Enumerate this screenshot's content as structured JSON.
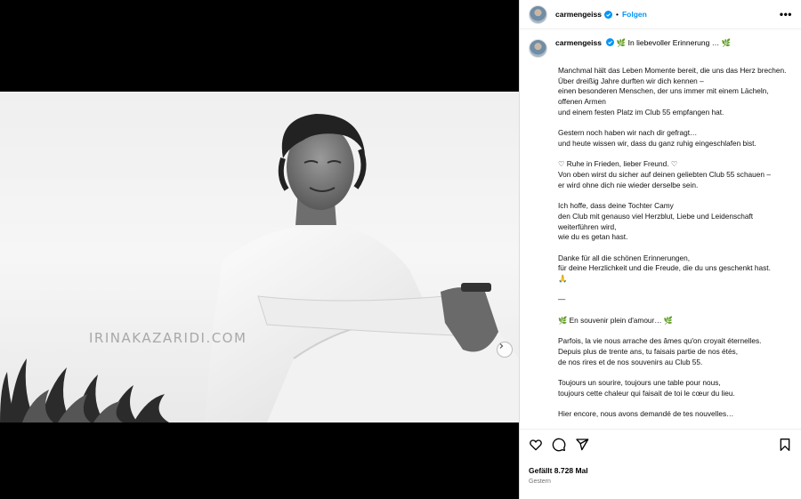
{
  "post": {
    "watermark": "IRINAKAZARIDI.COM",
    "carousel_dots": 2
  },
  "header": {
    "username": "carmengeiss",
    "separator": "•",
    "follow_label": "Folgen",
    "more_label": "•••",
    "verified_color": "#0095f6"
  },
  "caption": {
    "username": "carmengeiss",
    "first_line": "🌿 In liebevoller Erinnerung … 🌿",
    "paragraphs": [
      [
        "Manchmal hält das Leben Momente bereit, die uns das Herz brechen.",
        "Über dreißig Jahre durften wir dich kennen –",
        "einen besonderen Menschen, der uns immer mit einem Lächeln, offenen Armen",
        "und einem festen Platz im Club 55 empfangen hat."
      ],
      [
        "Gestern noch haben wir nach dir gefragt…",
        "und heute wissen wir, dass du ganz ruhig eingeschlafen bist."
      ],
      [
        "♡ Ruhe in Frieden, lieber Freund. ♡",
        "Von oben wirst du sicher auf deinen geliebten Club 55 schauen –",
        "er wird ohne dich nie wieder derselbe sein."
      ],
      [
        "Ich hoffe, dass deine Tochter Camy",
        "den Club mit genauso viel Herzblut, Liebe und Leidenschaft weiterführen wird,",
        "wie du es getan hast."
      ],
      [
        "Danke für all die schönen Erinnerungen,",
        "für deine Herzlichkeit und die Freude, die du uns geschenkt hast.",
        "🙏"
      ],
      [
        "—"
      ],
      [
        "🌿 En souvenir plein d'amour… 🌿"
      ],
      [
        "Parfois, la vie nous arrache des âmes qu'on croyait éternelles.",
        "Depuis plus de trente ans, tu faisais partie de nos étés,",
        "de nos rires et de nos souvenirs au Club 55."
      ],
      [
        "Toujours un sourire, toujours une table pour nous,",
        "toujours cette chaleur qui faisait de toi le cœur du lieu."
      ],
      [
        "Hier encore, nous avons demandé de tes nouvelles…"
      ]
    ]
  },
  "footer": {
    "likes": "Gefällt 8.728 Mal",
    "date": "Gestern"
  },
  "icons": [
    "heart-icon",
    "comment-icon",
    "share-icon",
    "bookmark-icon",
    "chevron-right-icon",
    "verified-badge-icon"
  ]
}
